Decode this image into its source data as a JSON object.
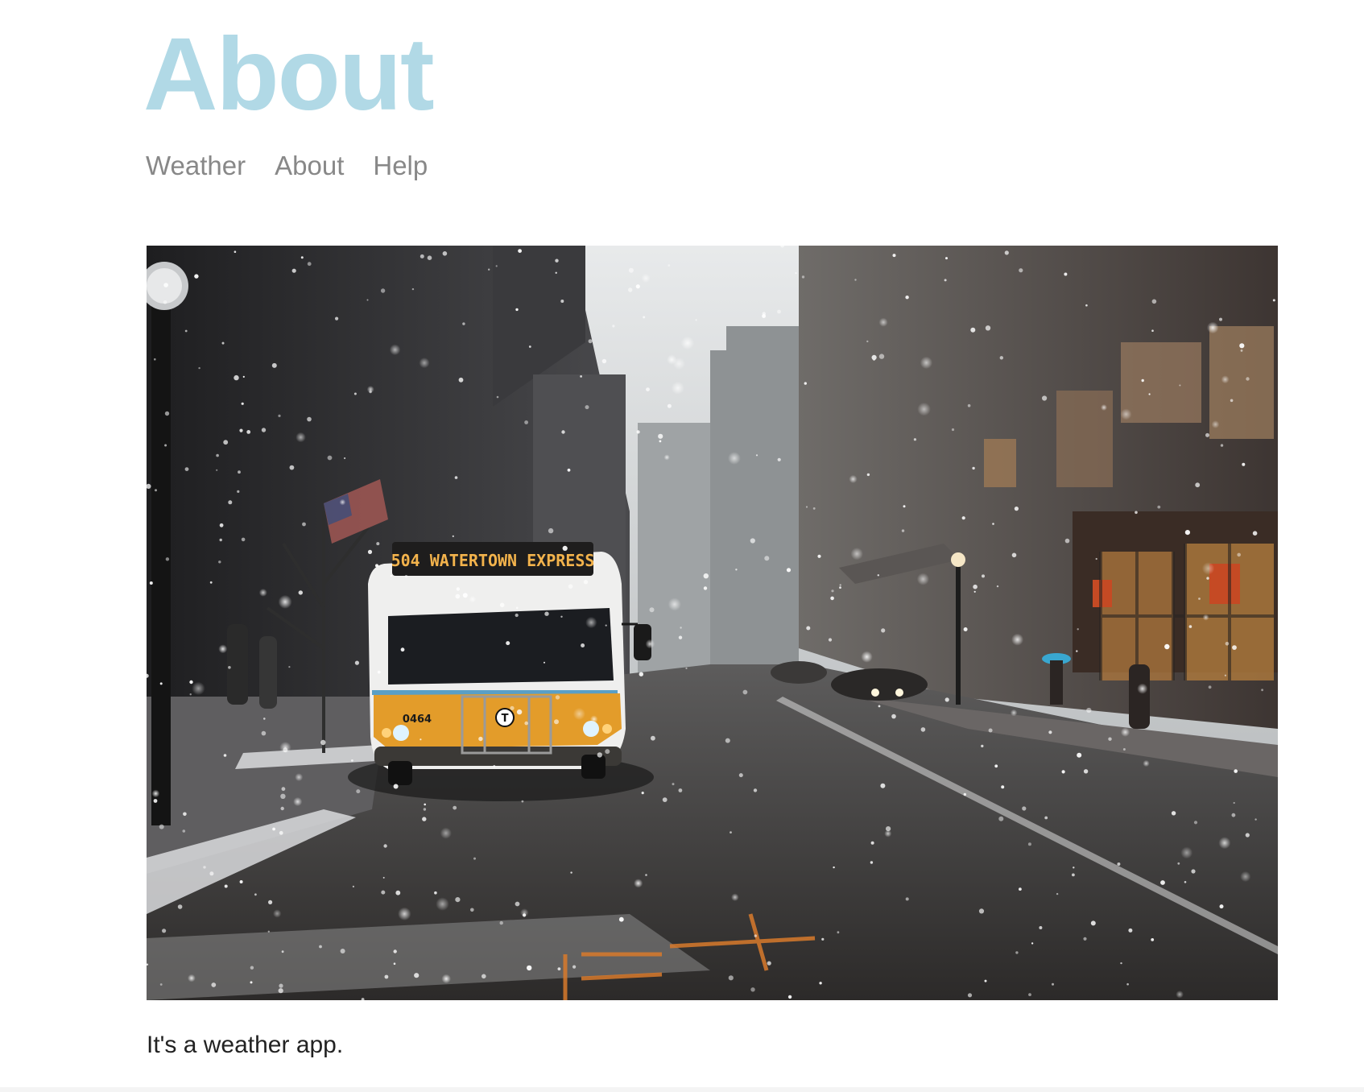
{
  "page": {
    "title": "About",
    "title_color": "#b1d9e6"
  },
  "nav": {
    "items": [
      {
        "label": "Weather"
      },
      {
        "label": "About"
      },
      {
        "label": "Help"
      }
    ],
    "link_color": "#888888"
  },
  "hero_image": {
    "bus_sign": "504 WATERTOWN EXPRESS",
    "bus_number": "0464",
    "bus_logo": "T"
  },
  "content": {
    "description": "It's a weather app."
  }
}
